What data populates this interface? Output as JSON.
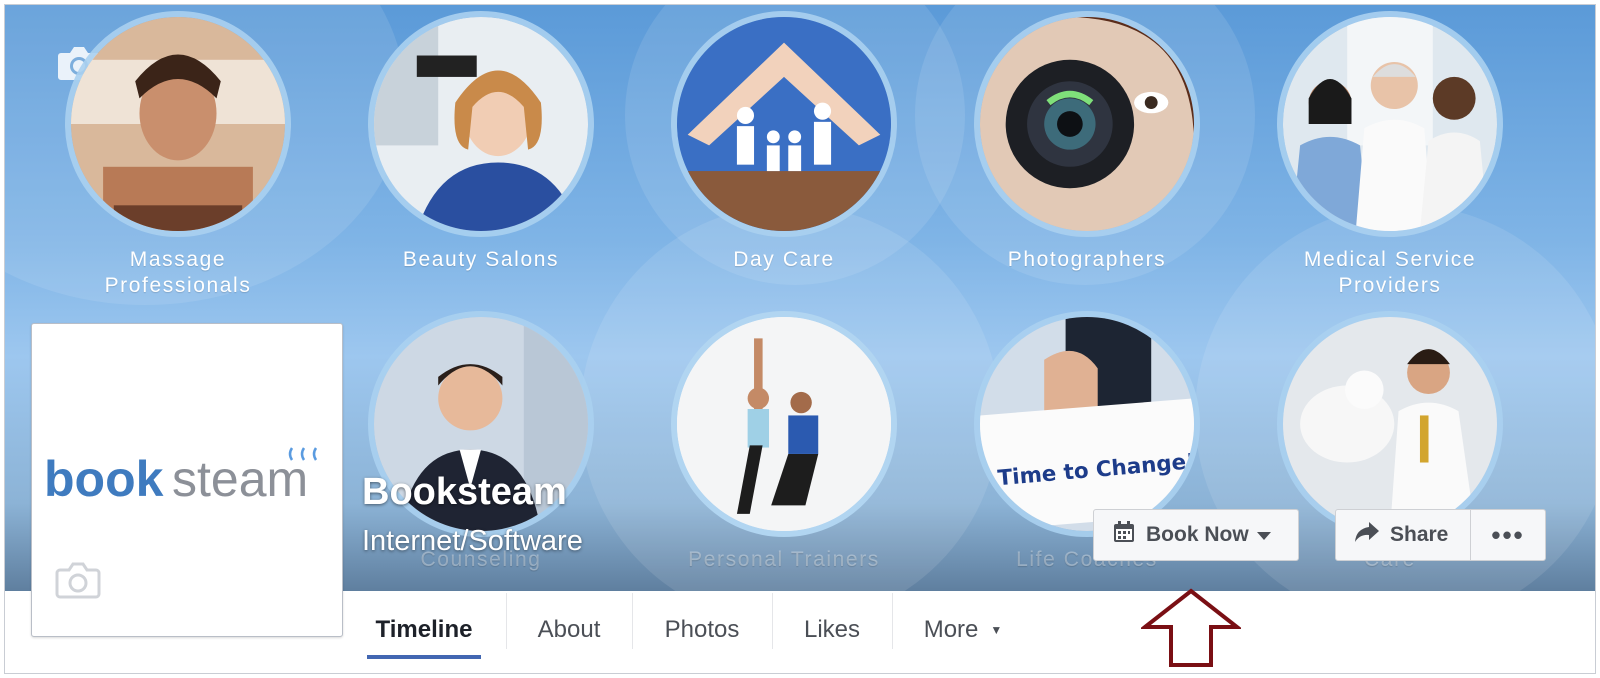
{
  "page": {
    "title": "Booksteam",
    "category": "Internet/Software",
    "logo_text": "booksteam"
  },
  "cover_tiles": [
    {
      "label": "Massage\nProfessionals",
      "icon": "massage-photo"
    },
    {
      "label": "Beauty Salons",
      "icon": "salon-photo"
    },
    {
      "label": "Day Care",
      "icon": "daycare-photo"
    },
    {
      "label": "Photographers",
      "icon": "camera-photo"
    },
    {
      "label": "Medical Service\nProviders",
      "icon": "doctors-photo"
    },
    {
      "label": "Counseling",
      "icon": "counselor-photo"
    },
    {
      "label": "Personal Trainers",
      "icon": "trainer-photo"
    },
    {
      "label": "Life Coaches",
      "icon": "coach-photo"
    },
    {
      "label": "Care",
      "icon": "vet-photo"
    }
  ],
  "coach_sign": "Time to Change!",
  "actions": {
    "book_now": "Book Now",
    "share": "Share",
    "more_dots": "•••"
  },
  "tabs": [
    {
      "label": "Timeline",
      "active": true
    },
    {
      "label": "About"
    },
    {
      "label": "Photos"
    },
    {
      "label": "Likes"
    },
    {
      "label": "More"
    }
  ],
  "tab_more_caret": "▼",
  "colors": {
    "accent": "#4267b2",
    "annotation_arrow": "#7a0f14",
    "logo_blue": "#3f7bbf"
  }
}
